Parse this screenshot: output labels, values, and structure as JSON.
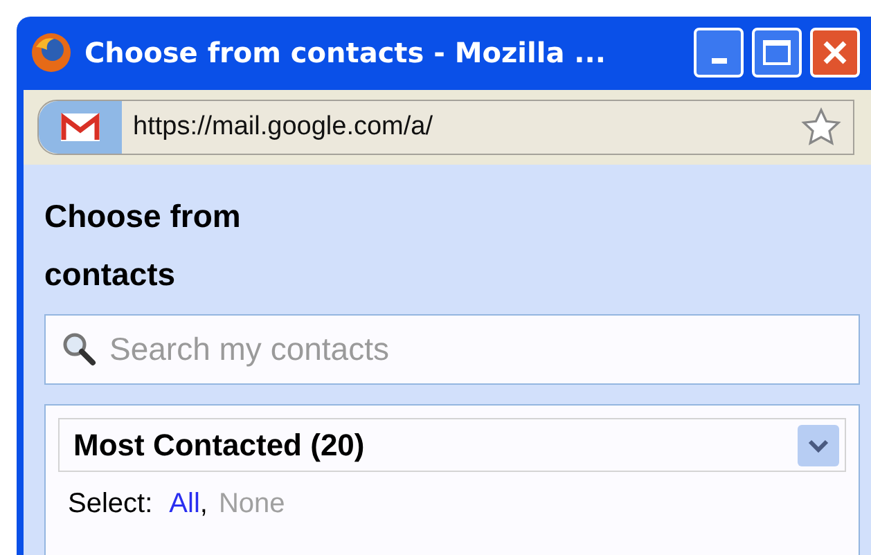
{
  "window": {
    "title": "Choose from contacts - Mozilla ..."
  },
  "address_bar": {
    "url": "https://mail.google.com/a/"
  },
  "heading": "Choose from contacts",
  "search": {
    "placeholder": "Search my contacts"
  },
  "group_dropdown": {
    "label": "Most Contacted (20)"
  },
  "select": {
    "label": "Select:",
    "separator": ",",
    "links": [
      {
        "label": "All",
        "disabled": false
      },
      {
        "label": "None",
        "disabled": true
      }
    ]
  }
}
